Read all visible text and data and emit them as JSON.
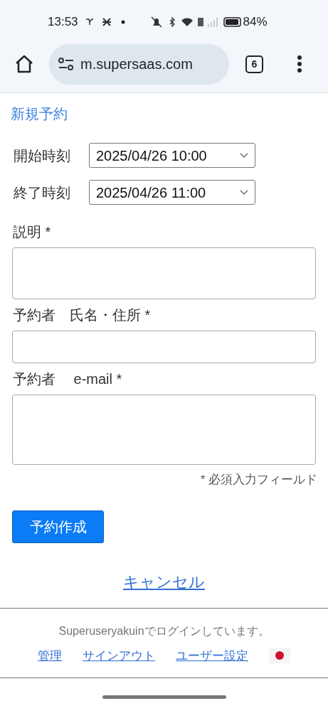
{
  "status_bar": {
    "time": "13:53",
    "battery": "84%"
  },
  "browser": {
    "url": "m.supersaas.com",
    "tab_count": "6"
  },
  "page": {
    "title": "新規予約",
    "time_fields": [
      {
        "label": "開始時刻",
        "value": "2025/04/26 10:00"
      },
      {
        "label": "終了時刻",
        "value": "2025/04/26 11:00"
      }
    ],
    "fields": [
      {
        "label": "説明 *",
        "kind": "textarea"
      },
      {
        "label": "予約者　氏名・住所 *",
        "kind": "input"
      },
      {
        "label": "予約者　 e-mail *",
        "kind": "textarea"
      }
    ],
    "required_note": "* 必須入力フィールド",
    "submit": "予約作成",
    "cancel": "キャンセル"
  },
  "footer": {
    "login_text": "Superuseryakuinでログインしています。",
    "links": [
      "管理",
      "サインアウト",
      "ユーザー設定"
    ]
  }
}
